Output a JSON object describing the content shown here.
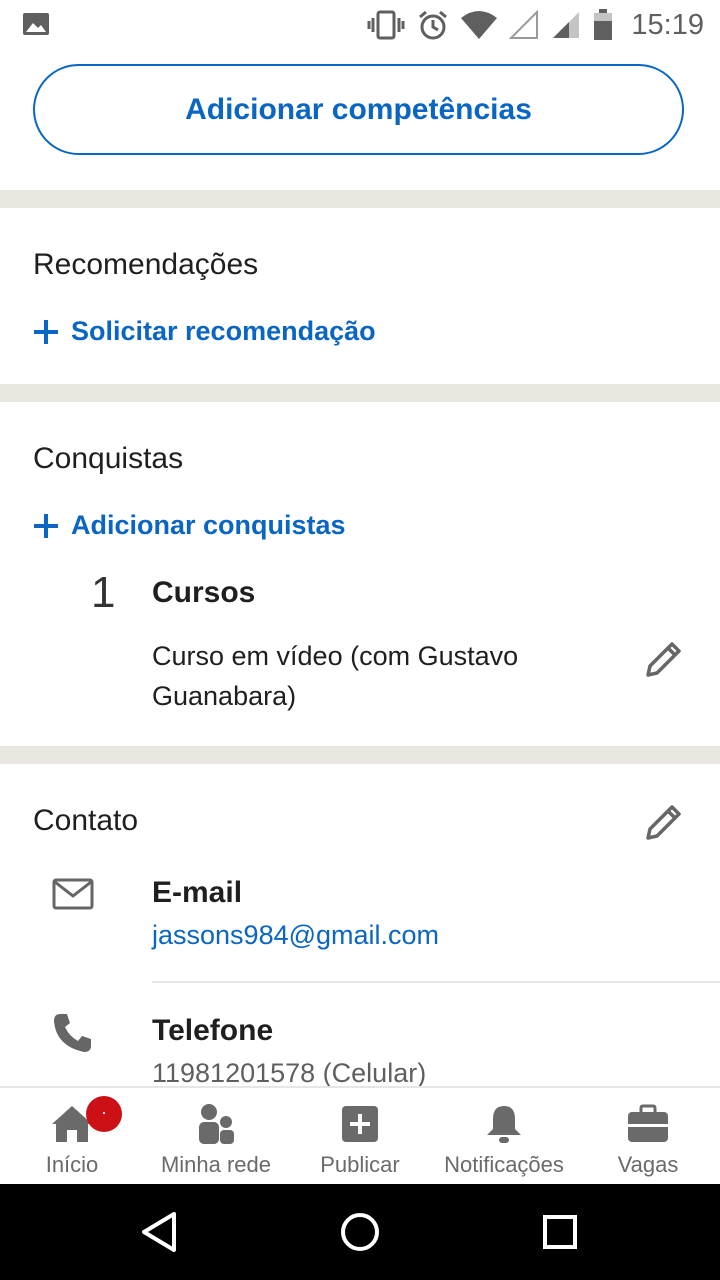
{
  "status_bar": {
    "time": "15:19",
    "icons": [
      "image-icon",
      "vibrate-icon",
      "alarm-icon",
      "wifi-icon",
      "signal-empty-icon",
      "signal-icon",
      "battery-icon"
    ]
  },
  "skills": {
    "add_button_label": "Adicionar competências"
  },
  "recommendations": {
    "title": "Recomendações",
    "request_link": "Solicitar recomendação"
  },
  "achievements": {
    "title": "Conquistas",
    "add_link": "Adicionar conquistas",
    "courses": {
      "count": "1",
      "category": "Cursos",
      "name": "Curso em vídeo (com Gustavo Guanabara)"
    }
  },
  "contact": {
    "title": "Contato",
    "email_label": "E-mail",
    "email_value": "jassons984@gmail.com",
    "phone_label": "Telefone",
    "phone_value": "11981201578 (Celular)"
  },
  "bottom_nav": {
    "items": [
      {
        "label": "Início",
        "icon": "home-icon",
        "badge": "·"
      },
      {
        "label": "Minha rede",
        "icon": "network-icon"
      },
      {
        "label": "Publicar",
        "icon": "post-icon"
      },
      {
        "label": "Notificações",
        "icon": "bell-icon"
      },
      {
        "label": "Vagas",
        "icon": "briefcase-icon"
      }
    ]
  },
  "colors": {
    "accent": "#0a66c2",
    "separator": "#e9e5df",
    "badge": "#cc1016",
    "icon_gray": "#6a6a6a"
  }
}
